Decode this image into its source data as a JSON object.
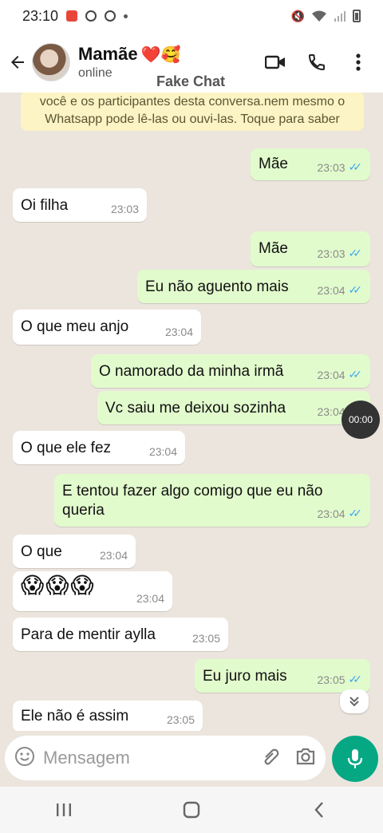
{
  "status_bar": {
    "time": "23:10"
  },
  "header": {
    "contact_name": "Mamãe",
    "contact_emoji": "❤️🥰",
    "contact_status": "online",
    "watermark": "Fake Chat"
  },
  "encryption_notice": "você e os participantes desta conversa.nem mesmo o Whatsapp pode lê-las ou ouvi-las. Toque para saber",
  "messages": [
    {
      "direction": "out",
      "text": "Mãe",
      "time": "23:03",
      "read": true
    },
    {
      "direction": "in",
      "text": "Oi filha",
      "time": "23:03"
    },
    {
      "direction": "out",
      "text": "Mãe",
      "time": "23:03",
      "read": true
    },
    {
      "direction": "out",
      "text": "Eu não aguento mais",
      "time": "23:04",
      "read": true
    },
    {
      "direction": "in",
      "text": "O que meu anjo",
      "time": "23:04"
    },
    {
      "direction": "out",
      "text": "O namorado da minha irmã",
      "time": "23:04",
      "read": true
    },
    {
      "direction": "out",
      "text": "Vc saiu me deixou sozinha",
      "time": "23:04",
      "read": true
    },
    {
      "direction": "in",
      "text": "O que ele fez",
      "time": "23:04"
    },
    {
      "direction": "out",
      "text": "E tentou fazer algo comigo que eu não queria",
      "time": "23:04",
      "read": true
    },
    {
      "direction": "in",
      "text": "O que",
      "time": "23:04"
    },
    {
      "direction": "in",
      "text": "😱😱😱",
      "time": "23:04"
    },
    {
      "direction": "in",
      "text": "Para de mentir aylla",
      "time": "23:05"
    },
    {
      "direction": "out",
      "text": "Eu juro mais",
      "time": "23:05",
      "read": true
    },
    {
      "direction": "in",
      "text": "Ele não é assim",
      "time": "23:05"
    }
  ],
  "timer_badge": "00:00",
  "input": {
    "placeholder": "Mensagem"
  },
  "colors": {
    "accent": "#06a884",
    "outgoing_bubble": "#e2fbcd",
    "chat_background": "#ece5dd",
    "read_ticks": "#3ba7f0"
  }
}
